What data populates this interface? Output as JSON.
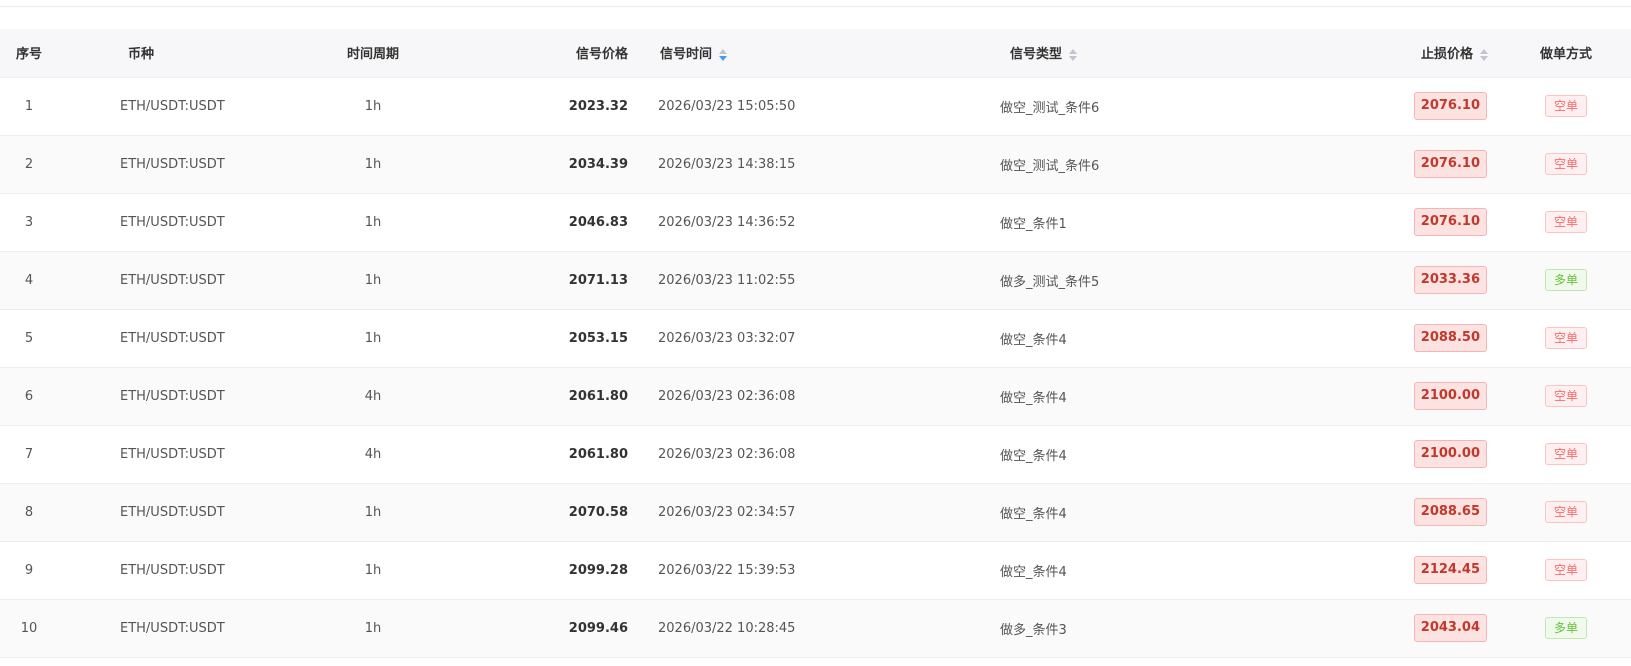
{
  "table": {
    "headers": {
      "index": "序号",
      "symbol": "币种",
      "timeframe": "时间周期",
      "signal_price": "信号价格",
      "signal_time": "信号时间",
      "signal_type": "信号类型",
      "stop_loss": "止损价格",
      "order_mode": "做单方式"
    },
    "rows": [
      {
        "index": "1",
        "symbol": "ETH/USDT:USDT",
        "timeframe": "1h",
        "signal_price": "2023.32",
        "signal_time": "2026/03/23 15:05:50",
        "signal_type": "做空_测试_条件6",
        "stop_loss": "2076.10",
        "order_mode": "空单",
        "mode_kind": "short"
      },
      {
        "index": "2",
        "symbol": "ETH/USDT:USDT",
        "timeframe": "1h",
        "signal_price": "2034.39",
        "signal_time": "2026/03/23 14:38:15",
        "signal_type": "做空_测试_条件6",
        "stop_loss": "2076.10",
        "order_mode": "空单",
        "mode_kind": "short"
      },
      {
        "index": "3",
        "symbol": "ETH/USDT:USDT",
        "timeframe": "1h",
        "signal_price": "2046.83",
        "signal_time": "2026/03/23 14:36:52",
        "signal_type": "做空_条件1",
        "stop_loss": "2076.10",
        "order_mode": "空单",
        "mode_kind": "short"
      },
      {
        "index": "4",
        "symbol": "ETH/USDT:USDT",
        "timeframe": "1h",
        "signal_price": "2071.13",
        "signal_time": "2026/03/23 11:02:55",
        "signal_type": "做多_测试_条件5",
        "stop_loss": "2033.36",
        "order_mode": "多单",
        "mode_kind": "long"
      },
      {
        "index": "5",
        "symbol": "ETH/USDT:USDT",
        "timeframe": "1h",
        "signal_price": "2053.15",
        "signal_time": "2026/03/23 03:32:07",
        "signal_type": "做空_条件4",
        "stop_loss": "2088.50",
        "order_mode": "空单",
        "mode_kind": "short"
      },
      {
        "index": "6",
        "symbol": "ETH/USDT:USDT",
        "timeframe": "4h",
        "signal_price": "2061.80",
        "signal_time": "2026/03/23 02:36:08",
        "signal_type": "做空_条件4",
        "stop_loss": "2100.00",
        "order_mode": "空单",
        "mode_kind": "short"
      },
      {
        "index": "7",
        "symbol": "ETH/USDT:USDT",
        "timeframe": "4h",
        "signal_price": "2061.80",
        "signal_time": "2026/03/23 02:36:08",
        "signal_type": "做空_条件4",
        "stop_loss": "2100.00",
        "order_mode": "空单",
        "mode_kind": "short"
      },
      {
        "index": "8",
        "symbol": "ETH/USDT:USDT",
        "timeframe": "1h",
        "signal_price": "2070.58",
        "signal_time": "2026/03/23 02:34:57",
        "signal_type": "做空_条件4",
        "stop_loss": "2088.65",
        "order_mode": "空单",
        "mode_kind": "short"
      },
      {
        "index": "9",
        "symbol": "ETH/USDT:USDT",
        "timeframe": "1h",
        "signal_price": "2099.28",
        "signal_time": "2026/03/22 15:39:53",
        "signal_type": "做空_条件4",
        "stop_loss": "2124.45",
        "order_mode": "空单",
        "mode_kind": "short"
      },
      {
        "index": "10",
        "symbol": "ETH/USDT:USDT",
        "timeframe": "1h",
        "signal_price": "2099.46",
        "signal_time": "2026/03/22 10:28:45",
        "signal_type": "做多_条件3",
        "stop_loss": "2043.04",
        "order_mode": "多单",
        "mode_kind": "long"
      }
    ]
  },
  "sort": {
    "signal_time": "descending",
    "signal_type": "none",
    "stop_loss": "none"
  },
  "colors": {
    "short_text": "#f56c6c",
    "long_text": "#67c23a",
    "stop_text": "#c0392b",
    "sort_active": "#409eff"
  }
}
